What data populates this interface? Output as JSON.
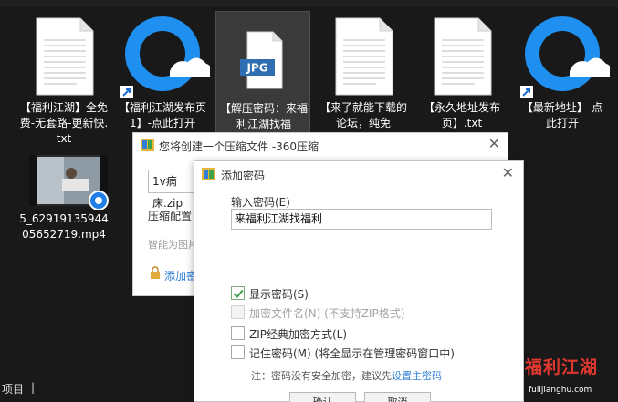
{
  "files": [
    {
      "label": "【福利江湖】全免费-无套路-更新快.txt",
      "icon": "text-file-icon"
    },
    {
      "label": "【福利江湖发布页1】-点此打开",
      "icon": "browser-shortcut-icon"
    },
    {
      "label": "【解压密码：来福利江湖找福",
      "icon": "jpg-file-icon",
      "badge": "JPG"
    },
    {
      "label": "【来了就能下载的论坛，纯免",
      "icon": "text-file-icon"
    },
    {
      "label": "【永久地址发布页】.txt",
      "icon": "text-file-icon"
    },
    {
      "label": "【最新地址】-点此打开",
      "icon": "browser-shortcut-icon"
    },
    {
      "label": "5_6291913594405652719.mp4",
      "icon": "video-file-icon"
    }
  ],
  "statusbar": {
    "items": "项目",
    "sep": "|"
  },
  "dialog_back": {
    "title": "您将创建一个压缩文件 -360压缩",
    "filename": "1v病床.zip",
    "config_label": "压缩配置：",
    "smart_text": "智能为图片",
    "add_password_link": "添加密"
  },
  "dialog_front": {
    "title": "添加密码",
    "password_label": "输入密码(E)",
    "password_value": "来福利江湖找福利",
    "options": [
      {
        "label": "显示密码(S)",
        "checked": true,
        "disabled": false
      },
      {
        "label": "加密文件名(N) (不支持ZIP格式)",
        "checked": false,
        "disabled": true
      },
      {
        "label": "ZIP经典加密方式(L)",
        "checked": false,
        "disabled": false
      },
      {
        "label": "记住密码(M) (将全显示在管理密码窗口中)",
        "checked": false,
        "disabled": false
      }
    ],
    "note_prefix": "注：密码没有安全加密，建议先",
    "note_link": "设置主密码",
    "ok_label": "确认",
    "cancel_label": "取消"
  },
  "watermark": {
    "text": "福利江湖",
    "url": "fulijianghu.com"
  },
  "colors": {
    "accent_link": "#2f7fd6",
    "check_green": "#3e9e44",
    "watermark_red": "#e0382e"
  }
}
